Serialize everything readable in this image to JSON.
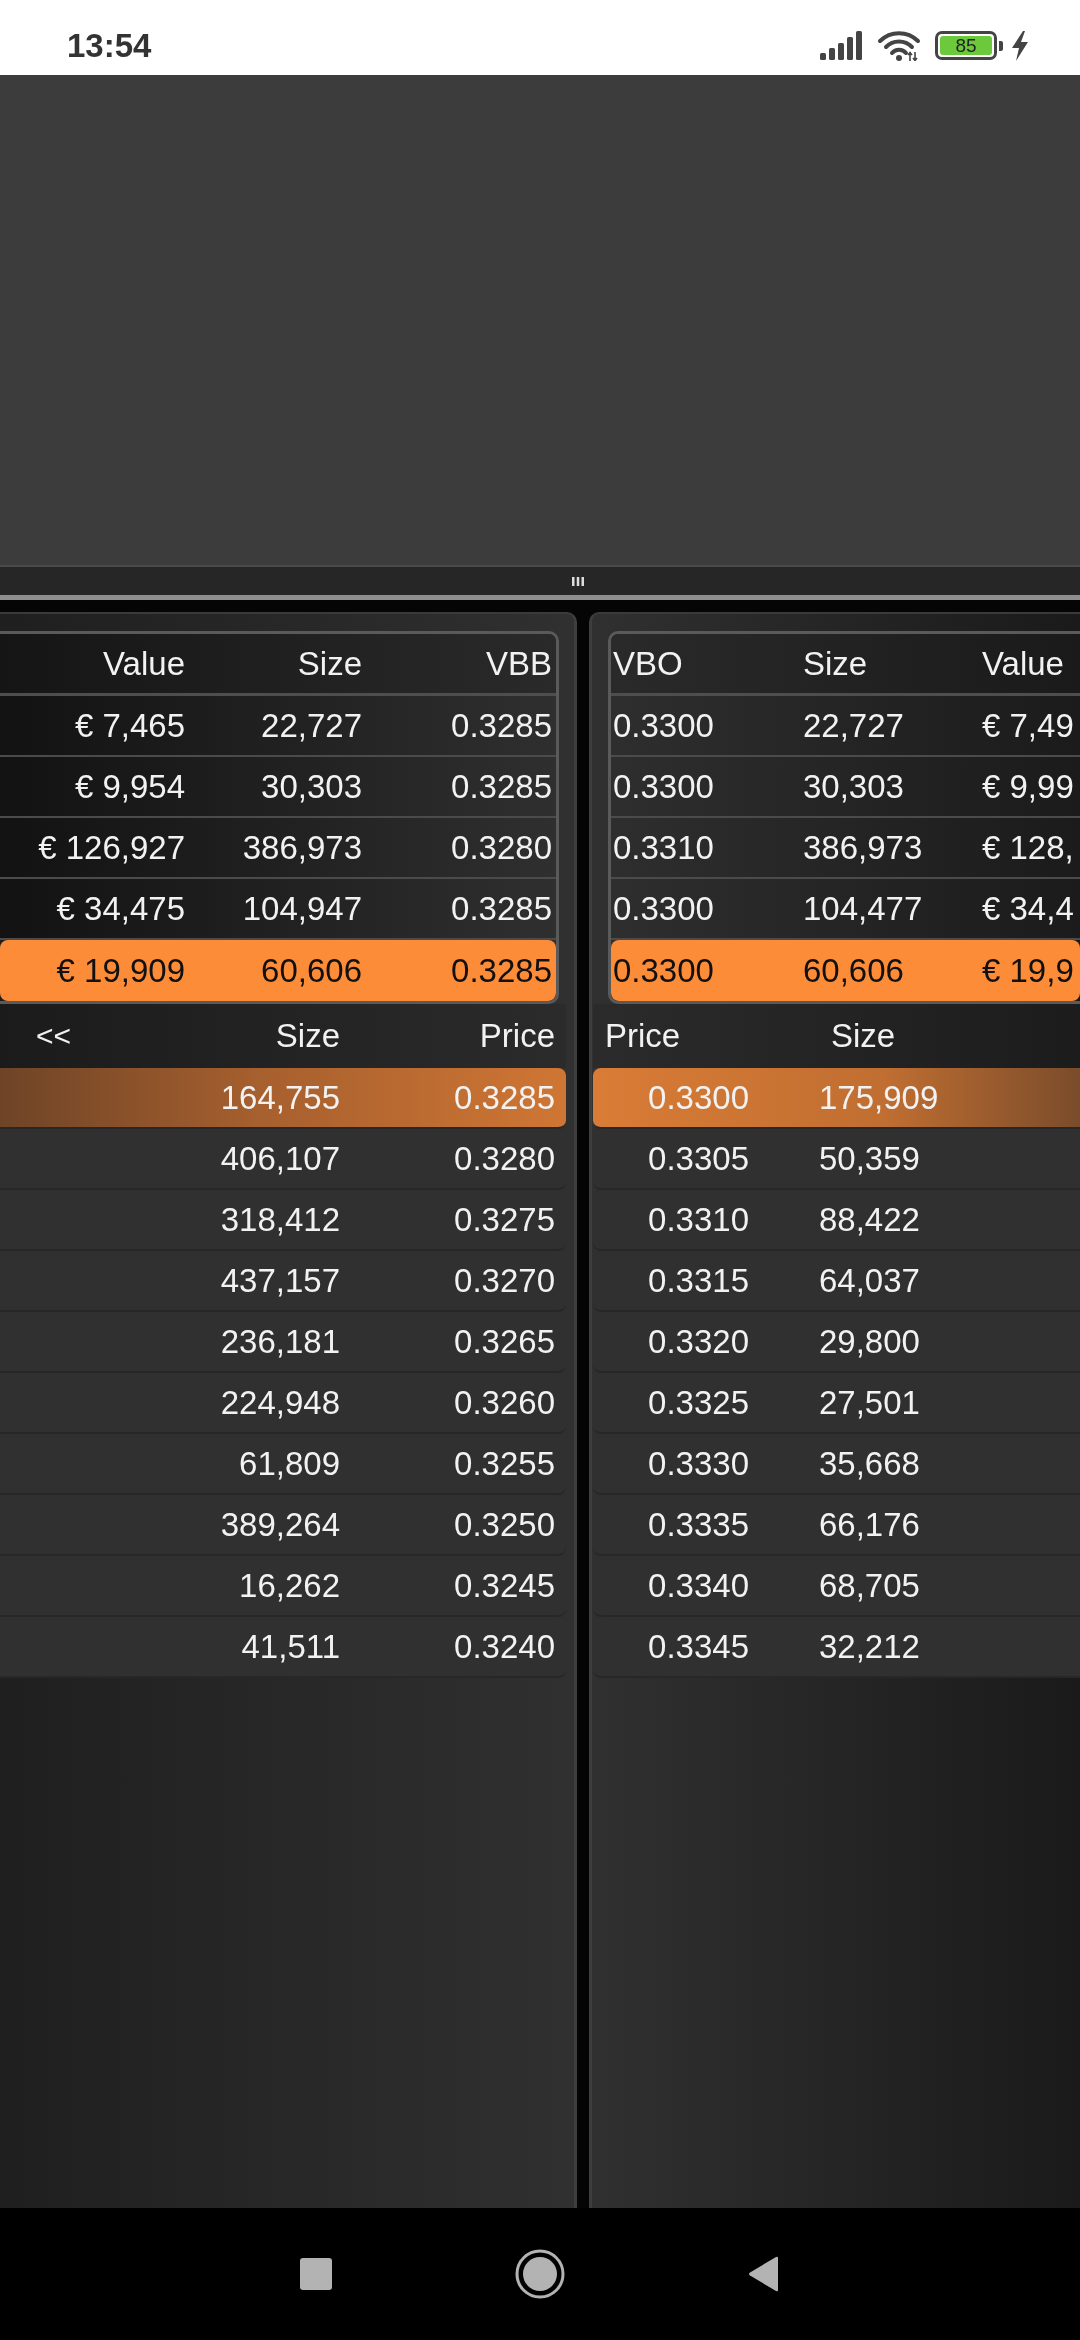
{
  "status_bar": {
    "time": "13:54",
    "battery": "85",
    "charging": true
  },
  "bid_trades": {
    "columns": [
      "Value",
      "Size",
      "VBB"
    ],
    "rows": [
      {
        "cells": [
          "€ 7,465",
          "22,727",
          "0.3285"
        ],
        "highlighted": false
      },
      {
        "cells": [
          "€ 9,954",
          "30,303",
          "0.3285"
        ],
        "highlighted": false
      },
      {
        "cells": [
          "€ 126,927",
          "386,973",
          "0.3280"
        ],
        "highlighted": false
      },
      {
        "cells": [
          "€ 34,475",
          "104,947",
          "0.3285"
        ],
        "highlighted": false
      },
      {
        "cells": [
          "€ 19,909",
          "60,606",
          "0.3285"
        ],
        "highlighted": true
      }
    ]
  },
  "ask_trades": {
    "columns": [
      "VBO",
      "Size",
      "Value"
    ],
    "rows": [
      {
        "cells": [
          "0.3300",
          "22,727",
          "€ 7,49"
        ],
        "highlighted": false
      },
      {
        "cells": [
          "0.3300",
          "30,303",
          "€ 9,99"
        ],
        "highlighted": false
      },
      {
        "cells": [
          "0.3310",
          "386,973",
          "€ 128,"
        ],
        "highlighted": false
      },
      {
        "cells": [
          "0.3300",
          "104,477",
          "€ 34,4"
        ],
        "highlighted": false
      },
      {
        "cells": [
          "0.3300",
          "60,606",
          "€ 19,9"
        ],
        "highlighted": true
      }
    ]
  },
  "bid_book": {
    "toggle": "<<",
    "columns": [
      "Size",
      "Price"
    ],
    "rows": [
      {
        "size": "164,755",
        "price": "0.3285",
        "highlighted": true
      },
      {
        "size": "406,107",
        "price": "0.3280",
        "highlighted": false
      },
      {
        "size": "318,412",
        "price": "0.3275",
        "highlighted": false
      },
      {
        "size": "437,157",
        "price": "0.3270",
        "highlighted": false
      },
      {
        "size": "236,181",
        "price": "0.3265",
        "highlighted": false
      },
      {
        "size": "224,948",
        "price": "0.3260",
        "highlighted": false
      },
      {
        "size": "61,809",
        "price": "0.3255",
        "highlighted": false
      },
      {
        "size": "389,264",
        "price": "0.3250",
        "highlighted": false
      },
      {
        "size": "16,262",
        "price": "0.3245",
        "highlighted": false
      },
      {
        "size": "41,511",
        "price": "0.3240",
        "highlighted": false
      }
    ]
  },
  "ask_book": {
    "columns": [
      "Price",
      "Size"
    ],
    "rows": [
      {
        "price": "0.3300",
        "size": "175,909",
        "highlighted": true
      },
      {
        "price": "0.3305",
        "size": "50,359",
        "highlighted": false
      },
      {
        "price": "0.3310",
        "size": "88,422",
        "highlighted": false
      },
      {
        "price": "0.3315",
        "size": "64,037",
        "highlighted": false
      },
      {
        "price": "0.3320",
        "size": "29,800",
        "highlighted": false
      },
      {
        "price": "0.3325",
        "size": "27,501",
        "highlighted": false
      },
      {
        "price": "0.3330",
        "size": "35,668",
        "highlighted": false
      },
      {
        "price": "0.3335",
        "size": "66,176",
        "highlighted": false
      },
      {
        "price": "0.3340",
        "size": "68,705",
        "highlighted": false
      },
      {
        "price": "0.3345",
        "size": "32,212",
        "highlighted": false
      }
    ]
  }
}
